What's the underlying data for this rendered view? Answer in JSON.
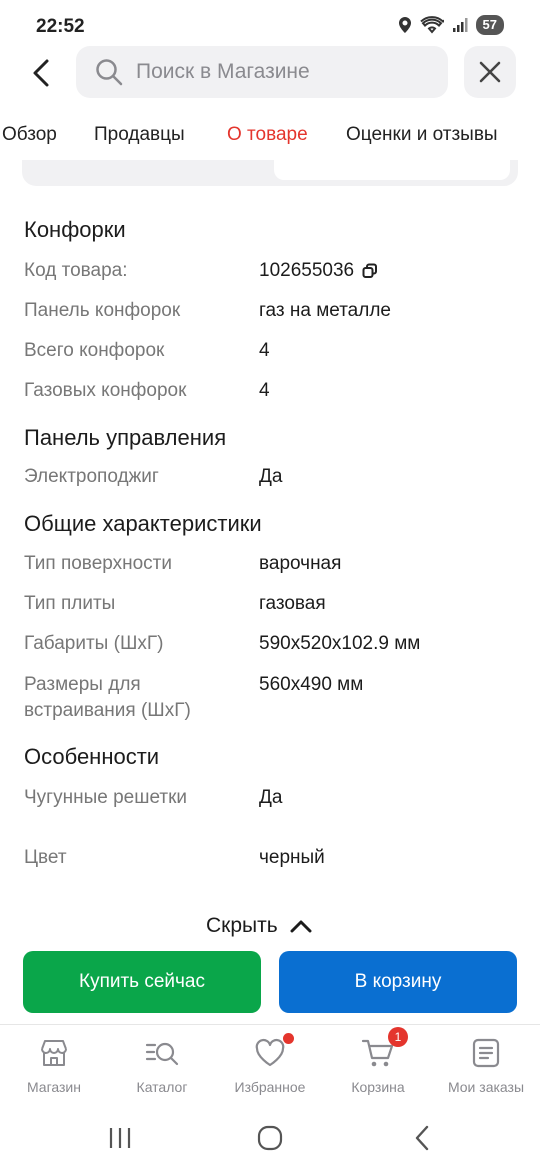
{
  "status": {
    "time": "22:52",
    "battery": "57"
  },
  "search": {
    "placeholder": "Поиск в Магазине"
  },
  "tabs": [
    {
      "label": "Обзор"
    },
    {
      "label": "Продавцы"
    },
    {
      "label": "О товаре",
      "active": true
    },
    {
      "label": "Оценки и отзывы"
    }
  ],
  "sections": {
    "burners": {
      "title": "Конфорки",
      "rows": [
        {
          "label": "Код товара:",
          "value": "102655036"
        },
        {
          "label": "Панель конфорок",
          "value": "газ на металле"
        },
        {
          "label": "Всего конфорок",
          "value": "4"
        },
        {
          "label": "Газовых конфорок",
          "value": "4"
        }
      ]
    },
    "control": {
      "title": "Панель управления",
      "rows": [
        {
          "label": "Электроподжиг",
          "value": "Да"
        }
      ]
    },
    "general": {
      "title": "Общие характеристики",
      "rows": [
        {
          "label": "Тип поверхности",
          "value": "варочная"
        },
        {
          "label": "Тип плиты",
          "value": "газовая"
        },
        {
          "label": "Габариты (ШхГ)",
          "value": "590x520x102.9 мм"
        },
        {
          "label": "Размеры для встраивания (ШхГ)",
          "value": "560x490 мм"
        }
      ]
    },
    "features": {
      "title": "Особенности",
      "rows": [
        {
          "label": "Чугунные решетки",
          "value": "Да"
        },
        {
          "label": "Цвет",
          "value": "черный"
        }
      ]
    }
  },
  "hide_label": "Скрыть",
  "actions": {
    "buy_now": "Купить сейчас",
    "add_to_cart": "В корзину"
  },
  "bottom_nav": [
    {
      "label": "Магазин",
      "icon": "store-icon"
    },
    {
      "label": "Каталог",
      "icon": "catalog-search-icon"
    },
    {
      "label": "Избранное",
      "icon": "heart-icon",
      "dot": true
    },
    {
      "label": "Корзина",
      "icon": "cart-icon",
      "badge": "1"
    },
    {
      "label": "Мои заказы",
      "icon": "orders-icon"
    }
  ],
  "colors": {
    "accent": "#e4352d",
    "buy": "#0aa64a",
    "cart": "#0a6fd1"
  }
}
